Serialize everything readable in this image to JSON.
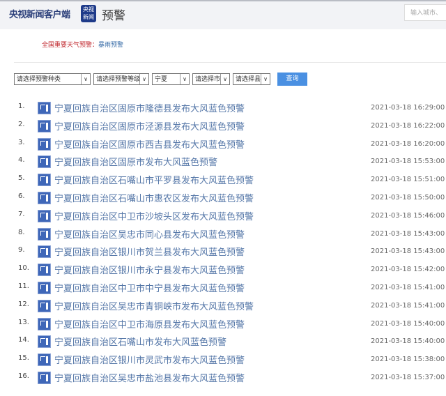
{
  "header": {
    "logo": "央视新闻客户端",
    "badge_line1": "央视",
    "badge_line2": "新闻",
    "title": "预警",
    "search_placeholder": "输入城市、"
  },
  "notice": {
    "label": "全国重要天气预警：",
    "link": "暴雨预警"
  },
  "filters": {
    "type": "请选择预警种类",
    "level": "请选择预警等级",
    "province": "宁夏",
    "city": "请选择市",
    "county": "请选择县",
    "query": "查询"
  },
  "items": [
    {
      "num": "1.",
      "title": "宁夏回族自治区固原市隆德县发布大风蓝色预警",
      "time": "2021-03-18 16:29:00"
    },
    {
      "num": "2.",
      "title": "宁夏回族自治区固原市泾源县发布大风蓝色预警",
      "time": "2021-03-18 16:22:00"
    },
    {
      "num": "3.",
      "title": "宁夏回族自治区固原市西吉县发布大风蓝色预警",
      "time": "2021-03-18 16:20:00"
    },
    {
      "num": "4.",
      "title": "宁夏回族自治区固原市发布大风蓝色预警",
      "time": "2021-03-18 15:53:00"
    },
    {
      "num": "5.",
      "title": "宁夏回族自治区石嘴山市平罗县发布大风蓝色预警",
      "time": "2021-03-18 15:51:00"
    },
    {
      "num": "6.",
      "title": "宁夏回族自治区石嘴山市惠农区发布大风蓝色预警",
      "time": "2021-03-18 15:50:00"
    },
    {
      "num": "7.",
      "title": "宁夏回族自治区中卫市沙坡头区发布大风蓝色预警",
      "time": "2021-03-18 15:46:00"
    },
    {
      "num": "8.",
      "title": "宁夏回族自治区吴忠市同心县发布大风蓝色预警",
      "time": "2021-03-18 15:43:00"
    },
    {
      "num": "9.",
      "title": "宁夏回族自治区银川市贺兰县发布大风蓝色预警",
      "time": "2021-03-18 15:43:00"
    },
    {
      "num": "10.",
      "title": "宁夏回族自治区银川市永宁县发布大风蓝色预警",
      "time": "2021-03-18 15:42:00"
    },
    {
      "num": "11.",
      "title": "宁夏回族自治区中卫市中宁县发布大风蓝色预警",
      "time": "2021-03-18 15:41:00"
    },
    {
      "num": "12.",
      "title": "宁夏回族自治区吴忠市青铜峡市发布大风蓝色预警",
      "time": "2021-03-18 15:41:00"
    },
    {
      "num": "13.",
      "title": "宁夏回族自治区中卫市海原县发布大风蓝色预警",
      "time": "2021-03-18 15:40:00"
    },
    {
      "num": "14.",
      "title": "宁夏回族自治区石嘴山市发布大风蓝色预警",
      "time": "2021-03-18 15:40:00"
    },
    {
      "num": "15.",
      "title": "宁夏回族自治区银川市灵武市发布大风蓝色预警",
      "time": "2021-03-18 15:38:00"
    },
    {
      "num": "16.",
      "title": "宁夏回族自治区吴忠市盐池县发布大风蓝色预警",
      "time": "2021-03-18 15:37:00"
    }
  ]
}
